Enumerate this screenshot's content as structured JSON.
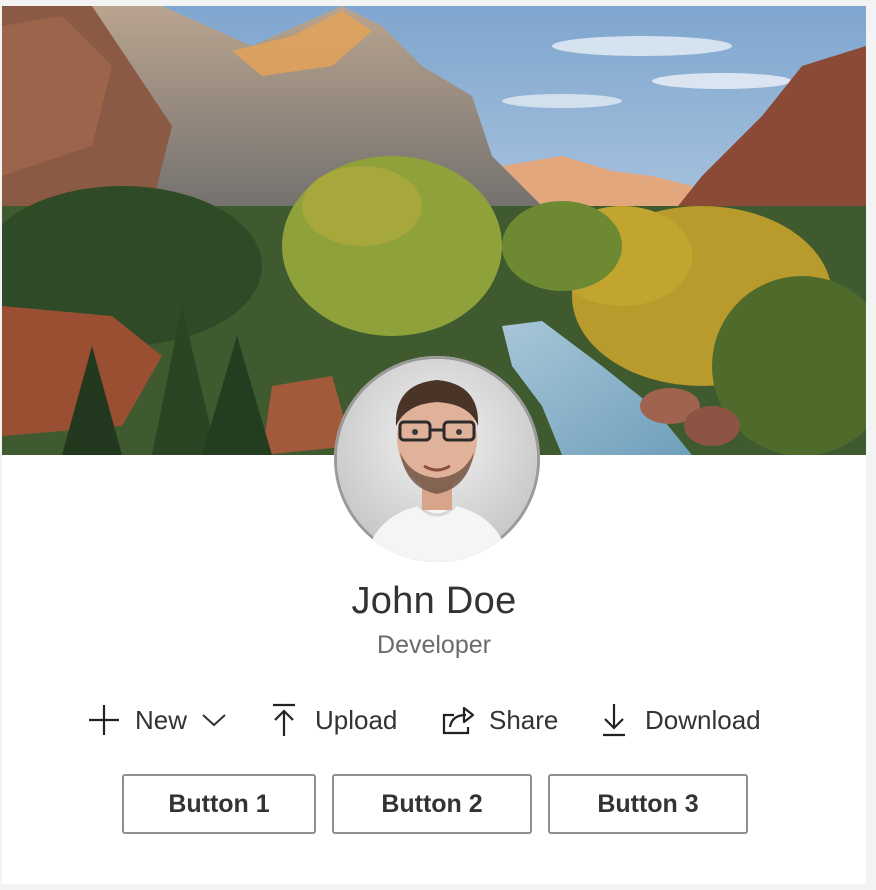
{
  "profile": {
    "name": "John Doe",
    "title": "Developer"
  },
  "commands": [
    {
      "label": "New",
      "icon": "plus-icon",
      "has_dropdown": true
    },
    {
      "label": "Upload",
      "icon": "upload-icon"
    },
    {
      "label": "Share",
      "icon": "share-icon"
    },
    {
      "label": "Download",
      "icon": "download-icon"
    }
  ],
  "buttons": [
    {
      "label": "Button 1"
    },
    {
      "label": "Button 2"
    },
    {
      "label": "Button 3"
    }
  ],
  "images": {
    "cover": "mountain-valley-cover-image",
    "avatar": "profile-photo"
  }
}
